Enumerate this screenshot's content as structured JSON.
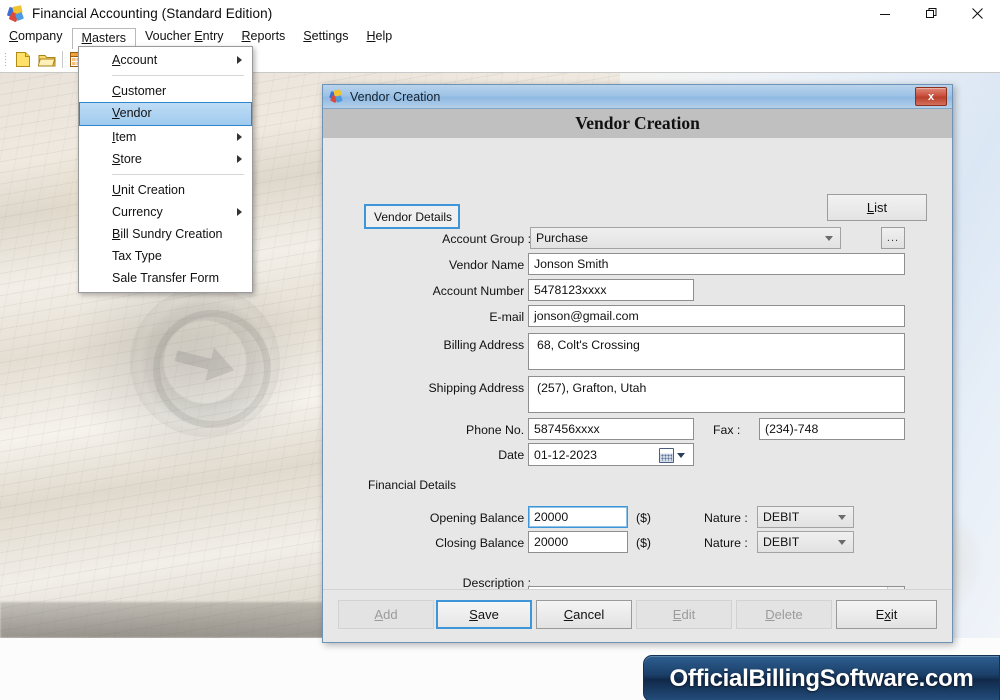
{
  "window": {
    "title": "Financial Accounting (Standard Edition)",
    "app_icon": "puzzle-icon",
    "controls": {
      "minimize": "minimize-icon",
      "restore": "restore-icon",
      "close": "close-icon"
    }
  },
  "menubar": {
    "items": [
      {
        "label": "Company",
        "accel": "C",
        "open": false
      },
      {
        "label": "Masters",
        "accel": "M",
        "open": true
      },
      {
        "label": "Voucher Entry",
        "accel": "E",
        "open": false
      },
      {
        "label": "Reports",
        "accel": "R",
        "open": false
      },
      {
        "label": "Settings",
        "accel": "S",
        "open": false
      },
      {
        "label": "Help",
        "accel": "H",
        "open": false
      }
    ]
  },
  "toolbar": {
    "buttons": [
      {
        "name": "new-document-icon"
      },
      {
        "name": "open-folder-icon"
      },
      {
        "name": "grid-table-icon"
      }
    ]
  },
  "dropdown": {
    "parent": "Masters",
    "items": [
      {
        "label": "Account",
        "submenu": true,
        "selected": false,
        "separator_after": true
      },
      {
        "label": "Customer",
        "submenu": false,
        "selected": false,
        "separator_after": false
      },
      {
        "label": "Vendor",
        "submenu": false,
        "selected": true,
        "separator_after": false
      },
      {
        "label": "Item",
        "submenu": true,
        "selected": false,
        "separator_after": false
      },
      {
        "label": "Store",
        "submenu": true,
        "selected": false,
        "separator_after": true
      },
      {
        "label": "Unit Creation",
        "submenu": false,
        "selected": false,
        "separator_after": false
      },
      {
        "label": "Currency",
        "submenu": true,
        "selected": false,
        "separator_after": false
      },
      {
        "label": "Bill Sundry Creation",
        "submenu": false,
        "selected": false,
        "separator_after": false
      },
      {
        "label": "Tax Type",
        "submenu": false,
        "selected": false,
        "separator_after": false
      },
      {
        "label": "Sale Transfer Form",
        "submenu": false,
        "selected": false,
        "separator_after": false
      }
    ]
  },
  "dialog": {
    "titlebar_text": "Vendor Creation",
    "header_text": "Vendor Creation",
    "close_label": "x",
    "tab_label": "Vendor Details",
    "list_button": "List",
    "fields": {
      "account_group": {
        "label": "Account Group :",
        "value": "Purchase",
        "type": "combo",
        "browse_button": "..."
      },
      "vendor_name": {
        "label": "Vendor Name :",
        "value": "Jonson Smith"
      },
      "account_number": {
        "label": "Account Number :",
        "value": "5478123xxxx"
      },
      "email": {
        "label": "E-mail :",
        "value": "jonson@gmail.com"
      },
      "billing_address": {
        "label": "Billing Address :",
        "value": "68, Colt's Crossing"
      },
      "shipping_address": {
        "label": "Shipping Address :",
        "value": "(257), Grafton, Utah"
      },
      "phone": {
        "label": "Phone No. :",
        "value": "587456xxxx"
      },
      "fax": {
        "label": "Fax :",
        "value": "(234)-748"
      },
      "date": {
        "label": "Date :",
        "value": "01-12-2023"
      }
    },
    "financial": {
      "group_label": "Financial Details",
      "opening_balance": {
        "label": "Opening Balance :",
        "value": "20000",
        "currency": "($)",
        "nature_label": "Nature :",
        "nature_value": "DEBIT",
        "focused": true
      },
      "closing_balance": {
        "label": "Closing Balance :",
        "value": "20000",
        "currency": "($)",
        "nature_label": "Nature :",
        "nature_value": "DEBIT",
        "focused": false
      },
      "description": {
        "label": "Description :",
        "value": ""
      }
    },
    "footer_buttons": [
      {
        "label": "Add",
        "accel": "A",
        "state": "disabled"
      },
      {
        "label": "Save",
        "accel": "S",
        "state": "focused"
      },
      {
        "label": "Cancel",
        "accel": "C",
        "state": "enabled"
      },
      {
        "label": "Edit",
        "accel": "E",
        "state": "disabled"
      },
      {
        "label": "Delete",
        "accel": "D",
        "state": "disabled"
      },
      {
        "label": "Exit",
        "accel": "x",
        "state": "enabled"
      }
    ]
  },
  "watermark": {
    "text": "OfficialBillingSoftware.com",
    "color": "#1b3f68"
  }
}
